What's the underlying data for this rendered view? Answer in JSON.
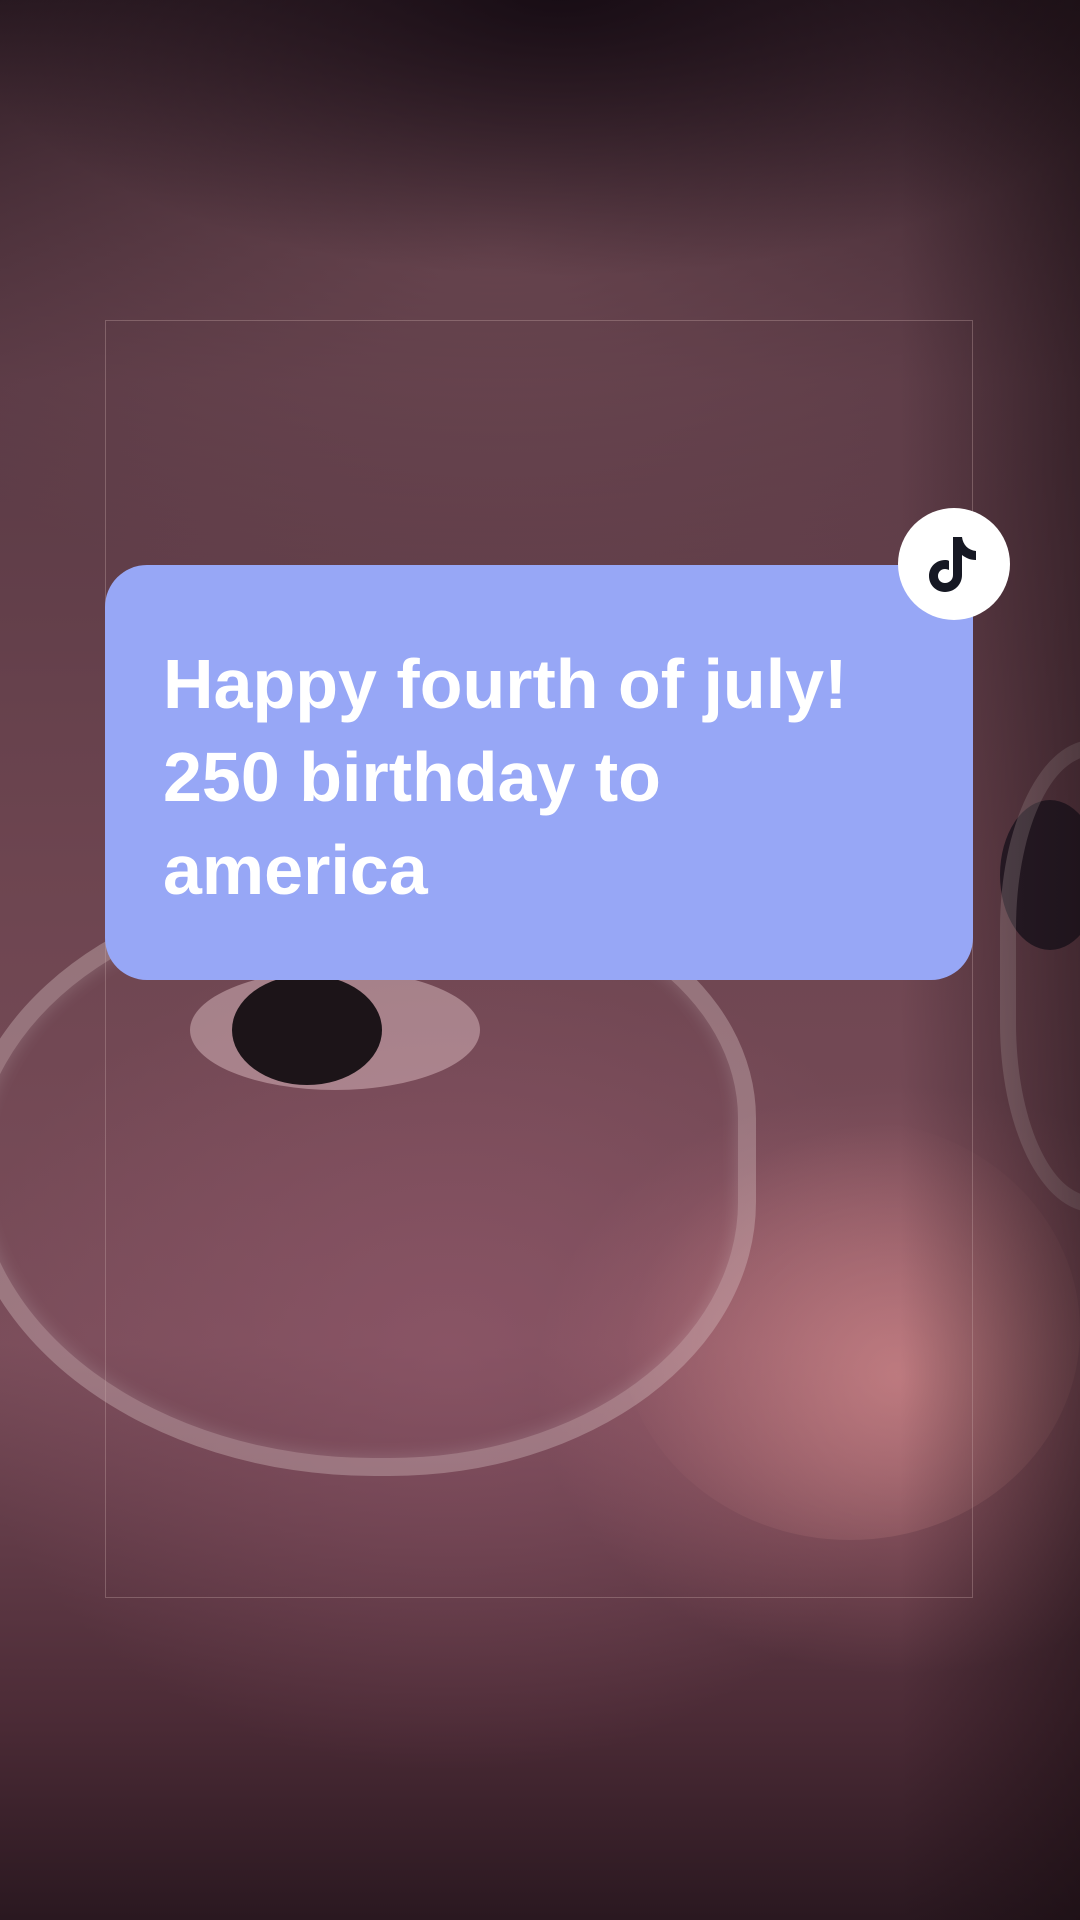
{
  "caption": {
    "text": "Happy fourth of july!\n250 birthday to\namerica",
    "background_color": "#97a7f6",
    "text_color": "#ffffff"
  },
  "badge": {
    "icon": "tiktok-logo-icon"
  }
}
